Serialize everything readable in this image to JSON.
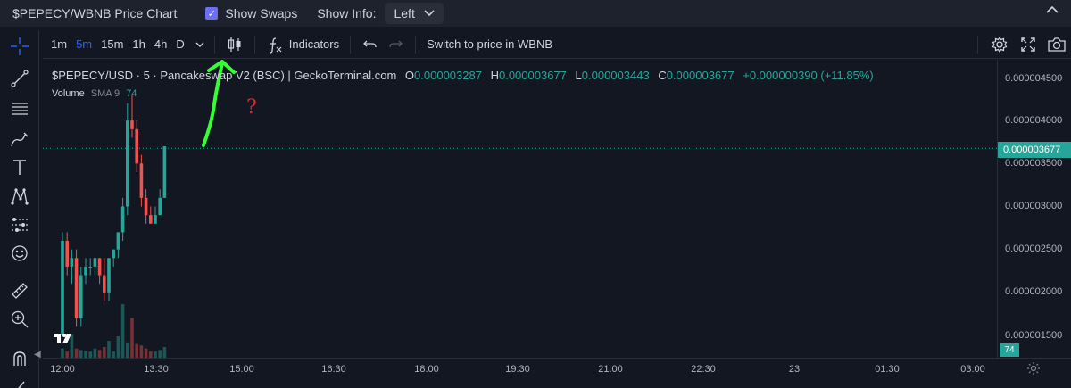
{
  "header": {
    "title": "$PEPECY/WBNB Price Chart",
    "show_swaps_label": "Show Swaps",
    "show_swaps_checked": true,
    "show_info_label": "Show Info:",
    "show_info_value": "Left"
  },
  "toolbar": {
    "timeframes": [
      "1m",
      "5m",
      "15m",
      "1h",
      "4h",
      "D"
    ],
    "active_timeframe": "5m",
    "indicators_label": "Indicators",
    "switch_label": "Switch to price in WBNB"
  },
  "legend": {
    "symbol": "$PEPECY/USD · 5 · Pancakeswap V2 (BSC) | GeckoTerminal.com",
    "o_key": "O",
    "o": "0.000003287",
    "h_key": "H",
    "h": "0.000003677",
    "l_key": "L",
    "l": "0.000003443",
    "c_key": "C",
    "c": "0.000003677",
    "change": "+0.000000390 (+11.85%)"
  },
  "volume_legend": {
    "name": "Volume",
    "sma": "SMA 9",
    "value": "74"
  },
  "price_axis": {
    "labels": [
      "0.000004500",
      "0.000004000",
      "0.000003500",
      "0.000003000",
      "0.000002500",
      "0.000002000",
      "0.000001500"
    ],
    "last_price": "0.000003677",
    "volume_badge": "74"
  },
  "time_axis": {
    "labels": [
      "12:00",
      "13:30",
      "15:00",
      "16:30",
      "18:00",
      "19:30",
      "21:00",
      "22:30",
      "23",
      "01:30",
      "03:00"
    ]
  },
  "annotation": {
    "question_mark": "?"
  },
  "colors": {
    "up": "#26a69a",
    "down": "#ef5350",
    "accent": "#2962ff",
    "arrow": "#33ff33"
  },
  "chart_data": {
    "type": "candlestick",
    "interval": "5m",
    "y_range": [
      1.2e-06,
      4.7e-06
    ],
    "candles": [
      {
        "o": 1.5e-06,
        "h": 2.7e-06,
        "l": 1.5e-06,
        "c": 2.6e-06
      },
      {
        "o": 2.6e-06,
        "h": 2.7e-06,
        "l": 2.2e-06,
        "c": 2.3e-06
      },
      {
        "o": 2.3e-06,
        "h": 2.5e-06,
        "l": 2.1e-06,
        "c": 2.4e-06
      },
      {
        "o": 2.4e-06,
        "h": 2.5e-06,
        "l": 1.6e-06,
        "c": 1.7e-06
      },
      {
        "o": 1.7e-06,
        "h": 2.3e-06,
        "l": 1.6e-06,
        "c": 2.2e-06
      },
      {
        "o": 2.2e-06,
        "h": 2.4e-06,
        "l": 2.1e-06,
        "c": 2.3e-06
      },
      {
        "o": 2.3e-06,
        "h": 2.4e-06,
        "l": 2.2e-06,
        "c": 2.3e-06
      },
      {
        "o": 2.3e-06,
        "h": 2.4e-06,
        "l": 2.2e-06,
        "c": 2.4e-06
      },
      {
        "o": 2.4e-06,
        "h": 2.4e-06,
        "l": 2.1e-06,
        "c": 2.2e-06
      },
      {
        "o": 2.2e-06,
        "h": 2.4e-06,
        "l": 1.9e-06,
        "c": 2e-06
      },
      {
        "o": 2e-06,
        "h": 2.4e-06,
        "l": 1.9e-06,
        "c": 2.4e-06
      },
      {
        "o": 2.4e-06,
        "h": 2.5e-06,
        "l": 2.3e-06,
        "c": 2.5e-06
      },
      {
        "o": 2.5e-06,
        "h": 2.7e-06,
        "l": 2.4e-06,
        "c": 2.7e-06
      },
      {
        "o": 2.7e-06,
        "h": 3.1e-06,
        "l": 2.6e-06,
        "c": 3e-06
      },
      {
        "o": 3e-06,
        "h": 4.2e-06,
        "l": 2.9e-06,
        "c": 4e-06
      },
      {
        "o": 4e-06,
        "h": 4.3e-06,
        "l": 3.8e-06,
        "c": 3.9e-06
      },
      {
        "o": 3.9e-06,
        "h": 4e-06,
        "l": 3.4e-06,
        "c": 3.5e-06
      },
      {
        "o": 3.5e-06,
        "h": 3.6e-06,
        "l": 3e-06,
        "c": 3.1e-06
      },
      {
        "o": 3.1e-06,
        "h": 3.2e-06,
        "l": 2.8e-06,
        "c": 2.9e-06
      },
      {
        "o": 2.9e-06,
        "h": 3e-06,
        "l": 2.8e-06,
        "c": 2.8e-06
      },
      {
        "o": 2.8e-06,
        "h": 3e-06,
        "l": 2.8e-06,
        "c": 2.9e-06
      },
      {
        "o": 2.9e-06,
        "h": 3.2e-06,
        "l": 2.9e-06,
        "c": 3.1e-06
      },
      {
        "o": 3.1e-06,
        "h": 3.7e-06,
        "l": 3.1e-06,
        "c": 3.7e-06
      }
    ],
    "volumes": [
      12,
      8,
      30,
      12,
      10,
      9,
      8,
      12,
      10,
      14,
      22,
      8,
      28,
      70,
      20,
      52,
      18,
      16,
      12,
      8,
      8,
      10,
      14
    ]
  }
}
